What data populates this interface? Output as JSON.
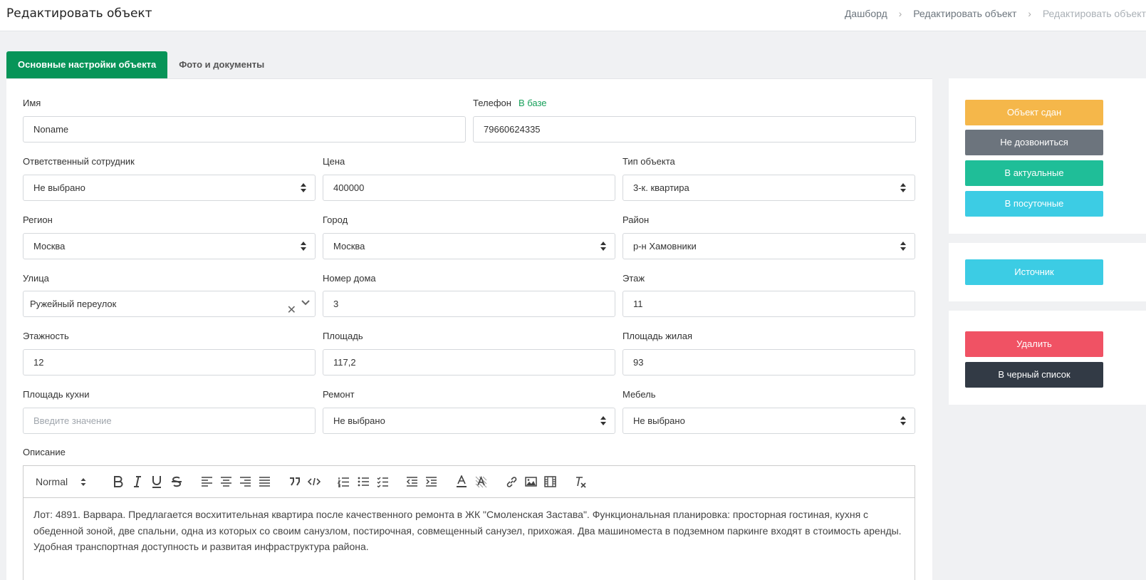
{
  "header": {
    "title": "Редактировать объект",
    "breadcrumb": [
      "Дашборд",
      "Редактировать объект",
      "Редактировать объект"
    ]
  },
  "tabs": [
    {
      "label": "Основные настройки объекта",
      "active": true
    },
    {
      "label": "Фото и документы",
      "active": false
    }
  ],
  "form": {
    "name": {
      "label": "Имя",
      "value": "Noname"
    },
    "phone": {
      "label": "Телефон",
      "hint": "В базе",
      "value": "79660624335"
    },
    "employee": {
      "label": "Ответственный сотрудник",
      "value": "Не выбрано"
    },
    "price": {
      "label": "Цена",
      "value": "400000"
    },
    "object_type": {
      "label": "Тип объекта",
      "value": "3-к. квартира"
    },
    "region": {
      "label": "Регион",
      "value": "Москва"
    },
    "city": {
      "label": "Город",
      "value": "Москва"
    },
    "district": {
      "label": "Район",
      "value": "р-н Хамовники"
    },
    "street": {
      "label": "Улица",
      "value": "Ружейный переулок"
    },
    "house": {
      "label": "Номер дома",
      "value": "3"
    },
    "floor": {
      "label": "Этаж",
      "value": "11"
    },
    "floors": {
      "label": "Этажность",
      "value": "12"
    },
    "area": {
      "label": "Площадь",
      "value": "117,2"
    },
    "living_area": {
      "label": "Площадь жилая",
      "value": "93"
    },
    "kitchen_area": {
      "label": "Площадь кухни",
      "placeholder": "Введите значение"
    },
    "repair": {
      "label": "Ремонт",
      "value": "Не выбрано"
    },
    "furniture": {
      "label": "Мебель",
      "value": "Не выбрано"
    },
    "description": {
      "label": "Описание",
      "format": "Normal",
      "text": "Лот: 4891.  Варвара.  Предлагается восхитительная квартира после качественного ремонта в ЖК \"Смоленская Застава\". Функциональная планировка: просторная гостиная, кухня с обеденной зоной, две спальни, одна из которых со своим санузлом, постирочная, совмещенный санузел, прихожая. Два машиноместа в подземном паркинге входят в стоимость аренды. Удобная транспортная доступность и развитая инфраструктура района."
    }
  },
  "sidebar": {
    "status_buttons": [
      {
        "label": "Объект сдан",
        "color": "#f5b74a"
      },
      {
        "label": "Не дозвониться",
        "color": "#6c747d"
      },
      {
        "label": "В актуальные",
        "color": "#1fbe98"
      },
      {
        "label": "В посуточные",
        "color": "#3ccce4"
      }
    ],
    "source_button": {
      "label": "Источник",
      "color": "#3ccce4"
    },
    "action_buttons": [
      {
        "label": "Удалить",
        "color": "#f05264"
      },
      {
        "label": "В черный список",
        "color": "#323a45"
      }
    ]
  },
  "colors": {
    "accent": "#079458",
    "hint": "#17a05a"
  }
}
